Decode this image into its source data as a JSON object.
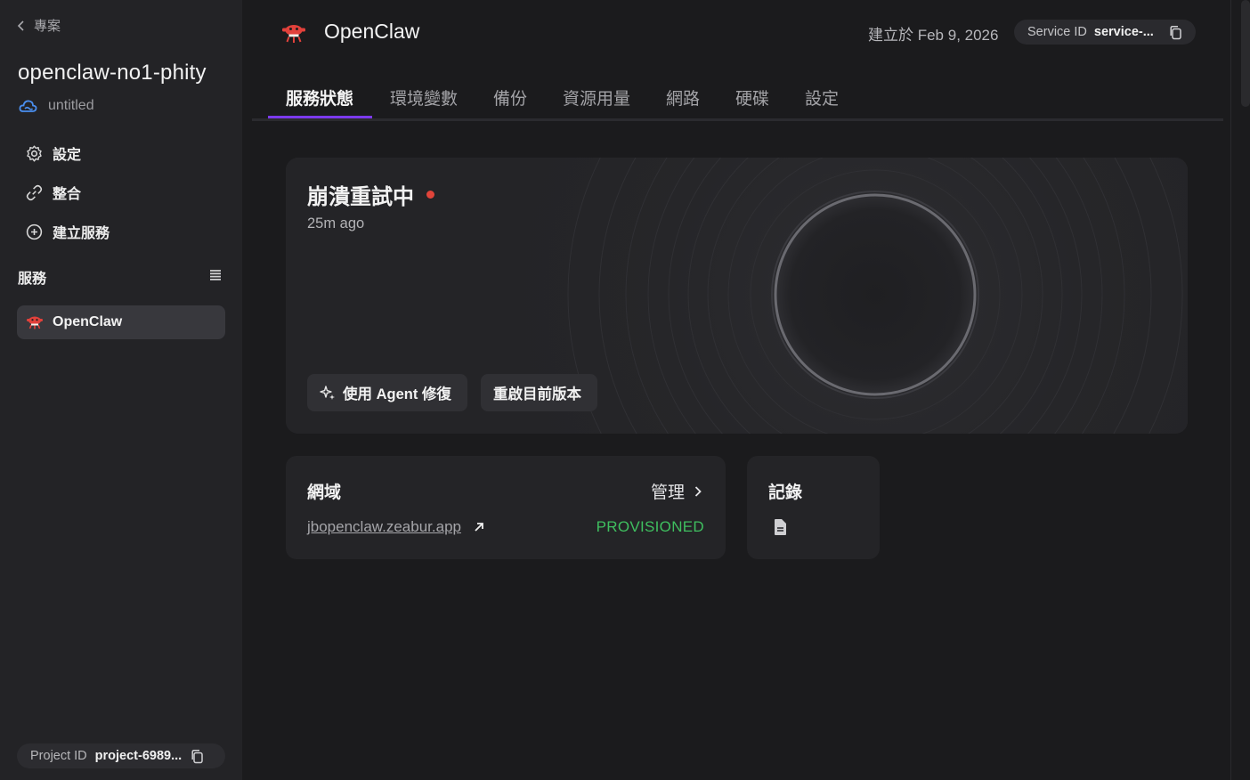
{
  "sidebar": {
    "back_label": "專案",
    "project_name": "openclaw-no1-phity",
    "environment": "untitled",
    "nav": [
      {
        "label": "設定",
        "icon": "gear-icon"
      },
      {
        "label": "整合",
        "icon": "link-icon"
      },
      {
        "label": "建立服務",
        "icon": "plus-circle-icon"
      }
    ],
    "section_title": "服務",
    "services": [
      {
        "label": "OpenClaw",
        "icon": "openclaw-logo-icon"
      }
    ],
    "project_id_label": "Project ID",
    "project_id_value": "project-6989..."
  },
  "header": {
    "service_name": "OpenClaw",
    "created": "建立於 Feb 9, 2026",
    "service_id_label": "Service ID",
    "service_id_value": "service-..."
  },
  "tabs": [
    {
      "label": "服務狀態",
      "active": true
    },
    {
      "label": "環境變數",
      "active": false
    },
    {
      "label": "備份",
      "active": false
    },
    {
      "label": "資源用量",
      "active": false
    },
    {
      "label": "網路",
      "active": false
    },
    {
      "label": "硬碟",
      "active": false
    },
    {
      "label": "設定",
      "active": false
    }
  ],
  "status": {
    "title": "崩潰重試中",
    "time": "25m ago",
    "indicator_color": "#e0443a",
    "buttons": [
      "使用 Agent 修復",
      "重啟目前版本"
    ]
  },
  "domain_card": {
    "title": "網域",
    "manage_label": "管理",
    "domain": "jbopenclaw.zeabur.app",
    "status": "PROVISIONED",
    "status_color": "#3fbf5f"
  },
  "logs_card": {
    "title": "記錄",
    "icon": "document-icon"
  },
  "colors": {
    "accent": "#7c3aed",
    "background": "#1b1b1d",
    "sidebar": "#232326",
    "card": "#242427"
  }
}
